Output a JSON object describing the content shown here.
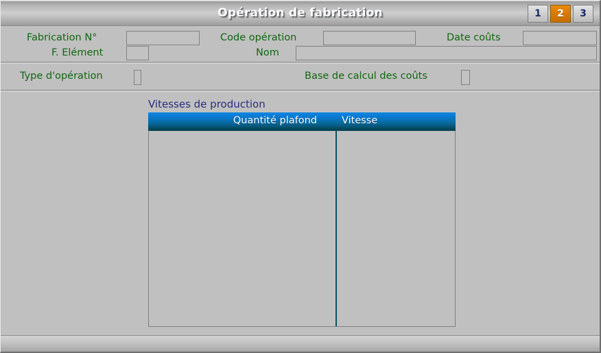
{
  "window": {
    "title": "Opération de fabrication",
    "accent_orange": "#d87a06",
    "label_color": "#116611",
    "grid_title_color": "#2b2b80",
    "panel_bg": "#c0c0c0"
  },
  "tabs": [
    {
      "label": "1",
      "active": false
    },
    {
      "label": "2",
      "active": true
    },
    {
      "label": "3",
      "active": false
    }
  ],
  "identification": {
    "fabrication_label": "Fabrication N°",
    "fabrication_value": "",
    "code_operation_label": "Code opération",
    "code_operation_value": "",
    "date_couts_label": "Date coûts",
    "date_couts_value": "",
    "f_element_label": "F. Elément",
    "f_element_value": "",
    "nom_label": "Nom",
    "nom_value": ""
  },
  "operation": {
    "type_label": "Type d'opération",
    "type_value": "",
    "base_label": "Base de calcul des coûts",
    "base_value": ""
  },
  "grid": {
    "title": "Vitesses de production",
    "columns": [
      {
        "label": "Quantité plafond"
      },
      {
        "label": "Vitesse"
      }
    ],
    "rows": [],
    "header_gradient_top": "#0f86e2",
    "header_gradient_bottom": "#044352",
    "divider_color": "#0a5262"
  },
  "statusbar": {
    "text": ""
  }
}
